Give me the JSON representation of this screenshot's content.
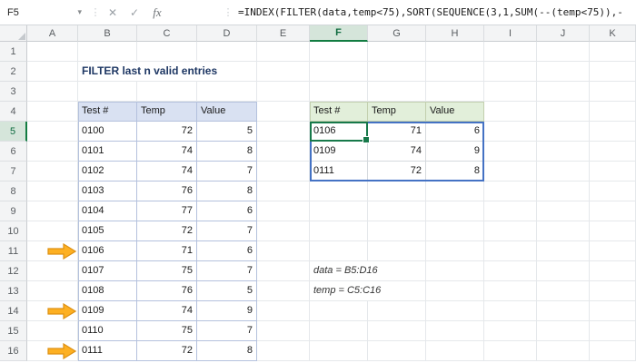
{
  "formula_bar": {
    "name_box": "F5",
    "formula": "=INDEX(FILTER(data,temp<75),SORT(SEQUENCE(3,1,SUM(--(temp<75)),-",
    "cancel_icon": "✕",
    "enter_icon": "✓",
    "fx_icon": "fx",
    "dropdown_icon": "▾",
    "separator_icon": "⋮"
  },
  "sheet": {
    "column_headers": [
      "A",
      "B",
      "C",
      "D",
      "E",
      "F",
      "G",
      "H",
      "I",
      "J",
      "K"
    ],
    "row_count": 16,
    "selection": {
      "active_cell": "F5",
      "spill_range": "F5:H7",
      "selected_column": "F",
      "selected_row": "5"
    },
    "title": {
      "cell": "B2",
      "text": "FILTER last n valid entries"
    },
    "annotations": [
      {
        "cell": "F12",
        "text": "data = B5:D16"
      },
      {
        "cell": "F13",
        "text": "temp = C5:C16"
      }
    ],
    "arrows": {
      "column": "A",
      "rows": [
        11,
        14,
        16
      ]
    }
  },
  "left_table": {
    "range": "B4:D16",
    "headers": [
      "Test #",
      "Temp",
      "Value"
    ],
    "rows": [
      [
        "0100",
        "72",
        "5"
      ],
      [
        "0101",
        "74",
        "8"
      ],
      [
        "0102",
        "74",
        "7"
      ],
      [
        "0103",
        "76",
        "8"
      ],
      [
        "0104",
        "77",
        "6"
      ],
      [
        "0105",
        "72",
        "7"
      ],
      [
        "0106",
        "71",
        "6"
      ],
      [
        "0107",
        "75",
        "7"
      ],
      [
        "0108",
        "76",
        "5"
      ],
      [
        "0109",
        "74",
        "9"
      ],
      [
        "0110",
        "75",
        "7"
      ],
      [
        "0111",
        "72",
        "8"
      ]
    ]
  },
  "result_table": {
    "range": "F4:H7",
    "headers": [
      "Test #",
      "Temp",
      "Value"
    ],
    "rows": [
      [
        "0106",
        "71",
        "6"
      ],
      [
        "0109",
        "74",
        "9"
      ],
      [
        "0111",
        "72",
        "8"
      ]
    ]
  },
  "colors": {
    "selection_green": "#17794a",
    "spill_blue": "#4472c4",
    "left_header_fill": "#d9e1f2",
    "result_header_fill": "#e2efda",
    "title_text": "#1f3864",
    "arrow_fill": "#fdb022"
  }
}
